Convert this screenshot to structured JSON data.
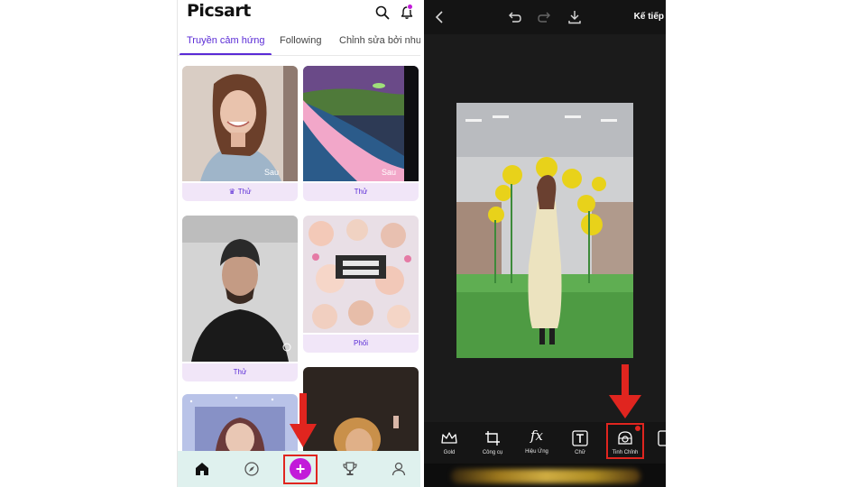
{
  "left_app": {
    "logo": "Picsart",
    "tabs": [
      {
        "label": "Truyền cảm hứng",
        "active": true
      },
      {
        "label": "Following",
        "active": false
      },
      {
        "label": "Chỉnh sửa bởi như",
        "active": false
      }
    ],
    "cards": [
      {
        "label": "Thử",
        "badge": "Sau",
        "crown": true
      },
      {
        "label": "Thử",
        "badge": "Sau",
        "crown": false
      },
      {
        "label": "Thử",
        "badge": "",
        "crown": false
      },
      {
        "label": "Phối",
        "badge": "",
        "crown": false
      }
    ],
    "bottom_nav": [
      "home-icon",
      "compass-icon",
      "create-plus-icon",
      "trophy-icon",
      "profile-icon"
    ],
    "plus_symbol": "+",
    "colors": {
      "accent": "#5a2bd6",
      "brand_magenta": "#c21bd9",
      "nav_bg": "#dff1ee",
      "highlight_red": "#e0251f"
    }
  },
  "right_app": {
    "next_label": "Kế tiếp",
    "top_icons": [
      "back-icon",
      "undo-icon",
      "redo-icon",
      "download-icon"
    ],
    "tools": [
      {
        "label": "Gold",
        "icon": "crown-icon"
      },
      {
        "label": "Công cụ",
        "icon": "crop-icon"
      },
      {
        "label": "Hiệu Ứng",
        "icon": "fx-icon",
        "glyph": "fx"
      },
      {
        "label": "Chữ",
        "icon": "text-icon",
        "glyph": "T"
      },
      {
        "label": "Tinh Chỉnh",
        "icon": "adjust-icon",
        "highlighted": true
      }
    ],
    "colors": {
      "canvas_bg": "#1b1b1b",
      "toolbar_bg": "#151515",
      "highlight_red": "#e0251f"
    }
  }
}
